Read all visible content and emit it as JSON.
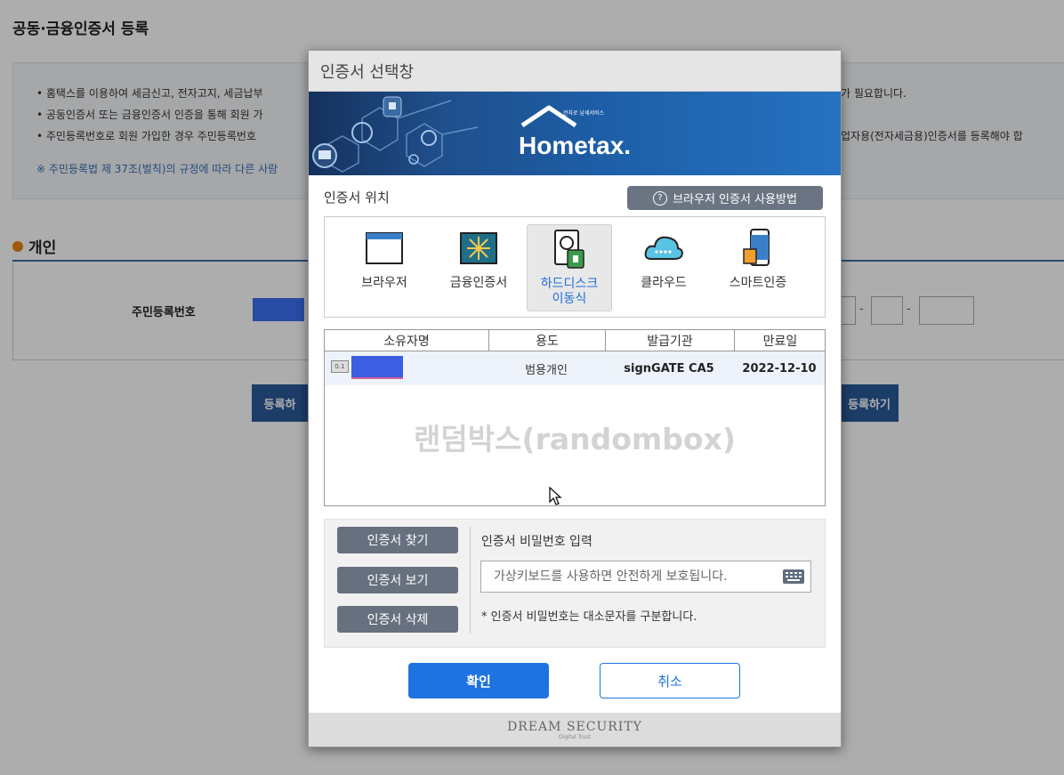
{
  "page": {
    "title": "공동·금융인증서 등록",
    "notice_lines": [
      "• 홈택스를 이용하여 세금신고, 전자고지, 세금납부",
      "• 공동인증서 또는 금융인증서 인증을 통해 회원 가",
      "• 주민등록번호로 회원 가입한 경우 주민등록번호"
    ],
    "notice_right_lines": [
      "가 필요합니다.",
      "업자용(전자세금용)인증서를 등록해야 합"
    ],
    "law_note": "※ 주민등록법 제 37조(벌칙)의 규정에 따라 다른 사람",
    "section_title": "개인",
    "rrn_label": "주민등록번호",
    "left_button": "등록하",
    "right_button": "등록하기"
  },
  "dialog": {
    "title": "인증서 선택창",
    "banner": {
      "logo_text": "Hometax.",
      "logo_sub": "전자로 납세서비스"
    },
    "location_label": "인증서 위치",
    "help_button": "브라우저 인증서 사용방법",
    "locations": [
      {
        "label": "브라우저",
        "icon": "browser-icon"
      },
      {
        "label": "금융인증서",
        "icon": "financial-cert-icon"
      },
      {
        "label": "하드디스크\n이동식",
        "icon": "harddisk-icon",
        "selected": true
      },
      {
        "label": "클라우드",
        "icon": "cloud-icon"
      },
      {
        "label": "스마트인증",
        "icon": "smart-cert-icon"
      }
    ],
    "table": {
      "headers": [
        "소유자명",
        "용도",
        "발급기관",
        "만료일"
      ],
      "rows": [
        {
          "owner": "",
          "usage": "범용개인",
          "issuer": "signGATE CA5",
          "expiry": "2022-12-10"
        }
      ],
      "watermark": "랜덤박스(randombox)"
    },
    "buttons": {
      "find": "인증서 찾기",
      "view": "인증서 보기",
      "delete": "인증서 삭제",
      "ok": "확인",
      "cancel": "취소"
    },
    "password": {
      "label": "인증서 비밀번호 입력",
      "placeholder": "가상키보드를 사용하면 안전하게 보호됩니다.",
      "note": "* 인증서 비밀번호는 대소문자를 구분합니다."
    },
    "footer": {
      "brand": "DREAM SECURITY",
      "tagline": "Digital Trust"
    }
  },
  "colors": {
    "accent": "#1f73e0",
    "bg_button": "#2a5a99",
    "dialog_button": "#67707f",
    "selected_label": "#1f6fd8"
  }
}
